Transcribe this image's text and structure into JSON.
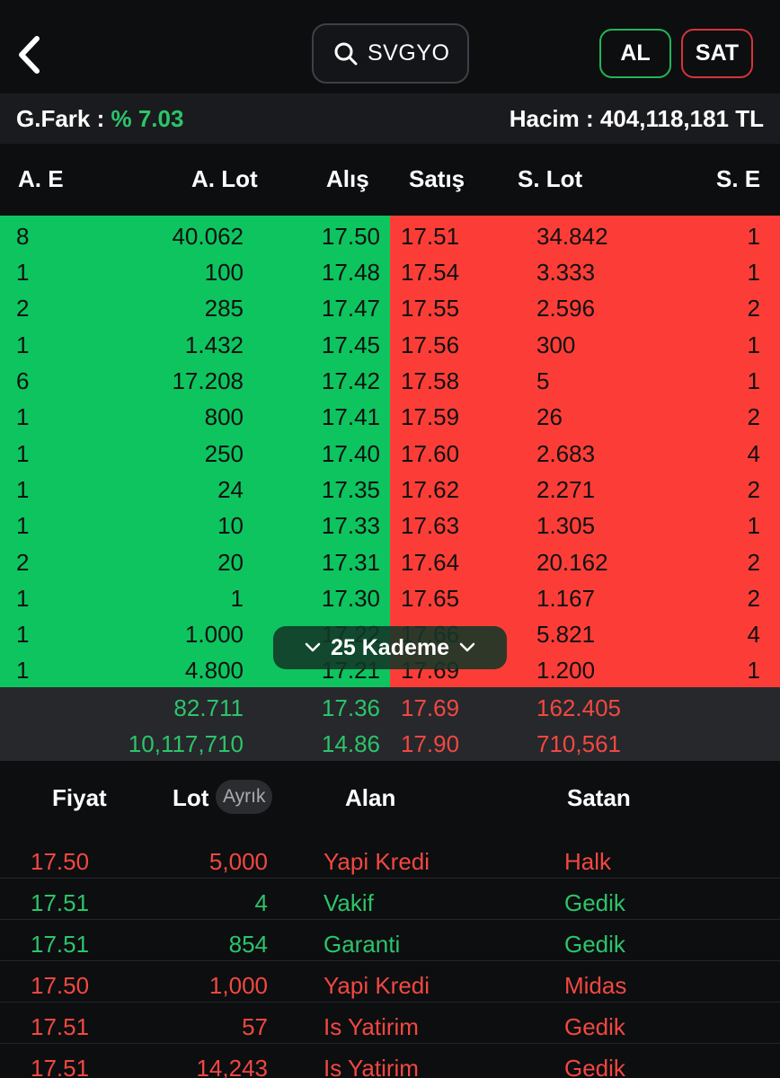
{
  "header": {
    "search_symbol": "SVGYO",
    "buy_label": "AL",
    "sell_label": "SAT"
  },
  "info": {
    "gfark_label": "G.Fark :",
    "gfark_value": "% 7.03",
    "hacim_label": "Hacim :",
    "hacim_value": "404,118,181 TL"
  },
  "depth_columns": {
    "ae": "A. E",
    "alot": "A. Lot",
    "alis": "Alış",
    "satis": "Satış",
    "slot": "S. Lot",
    "se": "S. E"
  },
  "depth_rows": [
    {
      "ae": "8",
      "alot": "40.062",
      "alis": "17.50",
      "satis": "17.51",
      "slot": "34.842",
      "se": "1"
    },
    {
      "ae": "1",
      "alot": "100",
      "alis": "17.48",
      "satis": "17.54",
      "slot": "3.333",
      "se": "1"
    },
    {
      "ae": "2",
      "alot": "285",
      "alis": "17.47",
      "satis": "17.55",
      "slot": "2.596",
      "se": "2"
    },
    {
      "ae": "1",
      "alot": "1.432",
      "alis": "17.45",
      "satis": "17.56",
      "slot": "300",
      "se": "1"
    },
    {
      "ae": "6",
      "alot": "17.208",
      "alis": "17.42",
      "satis": "17.58",
      "slot": "5",
      "se": "1"
    },
    {
      "ae": "1",
      "alot": "800",
      "alis": "17.41",
      "satis": "17.59",
      "slot": "26",
      "se": "2"
    },
    {
      "ae": "1",
      "alot": "250",
      "alis": "17.40",
      "satis": "17.60",
      "slot": "2.683",
      "se": "4"
    },
    {
      "ae": "1",
      "alot": "24",
      "alis": "17.35",
      "satis": "17.62",
      "slot": "2.271",
      "se": "2"
    },
    {
      "ae": "1",
      "alot": "10",
      "alis": "17.33",
      "satis": "17.63",
      "slot": "1.305",
      "se": "1"
    },
    {
      "ae": "2",
      "alot": "20",
      "alis": "17.31",
      "satis": "17.64",
      "slot": "20.162",
      "se": "2"
    },
    {
      "ae": "1",
      "alot": "1",
      "alis": "17.30",
      "satis": "17.65",
      "slot": "1.167",
      "se": "2"
    },
    {
      "ae": "1",
      "alot": "1.000",
      "alis": "17.22",
      "satis": "17.66",
      "slot": "5.821",
      "se": "4"
    },
    {
      "ae": "1",
      "alot": "4.800",
      "alis": "17.21",
      "satis": "17.69",
      "slot": "1.200",
      "se": "1"
    }
  ],
  "kademe_label": "25 Kademe",
  "summary": [
    {
      "alot": "82.711",
      "alis": "17.36",
      "satis": "17.69",
      "slot": "162.405"
    },
    {
      "alot": "10,117,710",
      "alis": "14.86",
      "satis": "17.90",
      "slot": "710,561"
    }
  ],
  "trade_columns": {
    "fiyat": "Fiyat",
    "lot": "Lot",
    "ayrik": "Ayrık",
    "alan": "Alan",
    "satan": "Satan"
  },
  "trades": [
    {
      "fiyat": "17.50",
      "lot": "5,000",
      "alan": "Yapi Kredi",
      "satan": "Halk",
      "side": "sell"
    },
    {
      "fiyat": "17.51",
      "lot": "4",
      "alan": "Vakif",
      "satan": "Gedik",
      "side": "buy"
    },
    {
      "fiyat": "17.51",
      "lot": "854",
      "alan": "Garanti",
      "satan": "Gedik",
      "side": "buy"
    },
    {
      "fiyat": "17.50",
      "lot": "1,000",
      "alan": "Yapi Kredi",
      "satan": "Midas",
      "side": "sell"
    },
    {
      "fiyat": "17.51",
      "lot": "57",
      "alan": "Is Yatirim",
      "satan": "Gedik",
      "side": "sell"
    },
    {
      "fiyat": "17.51",
      "lot": "14,243",
      "alan": "Is Yatirim",
      "satan": "Gedik",
      "side": "sell"
    }
  ],
  "colors": {
    "bid": "#0dc45f",
    "ask": "#fc3d37",
    "up_text": "#2cc46a",
    "down_text": "#f24840"
  }
}
